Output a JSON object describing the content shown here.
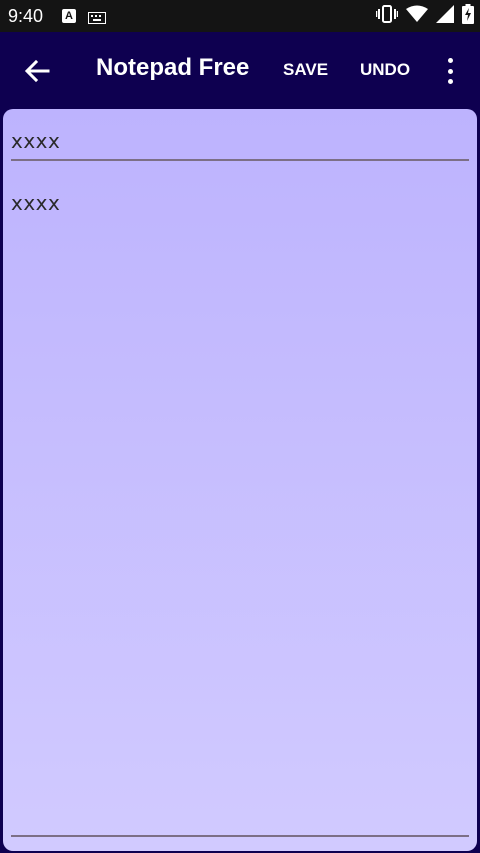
{
  "status_bar": {
    "time": "9:40",
    "a_icon_label": "A",
    "icons": [
      "a-notification-icon",
      "keyboard-icon",
      "vibrate-icon",
      "wifi-icon",
      "signal-icon",
      "battery-icon"
    ]
  },
  "app_bar": {
    "title": "Notepad Free",
    "save_label": "SAVE",
    "undo_label": "UNDO",
    "back_icon": "arrow-back-icon",
    "overflow_icon": "more-vert-icon"
  },
  "note": {
    "title_value": "xxxx",
    "body_value": "xxxx"
  },
  "colors": {
    "app_bar_bg": "#0e0050",
    "status_bar_bg": "#141414",
    "panel_top": "#bdb3fe",
    "panel_bottom": "#d1caff"
  }
}
